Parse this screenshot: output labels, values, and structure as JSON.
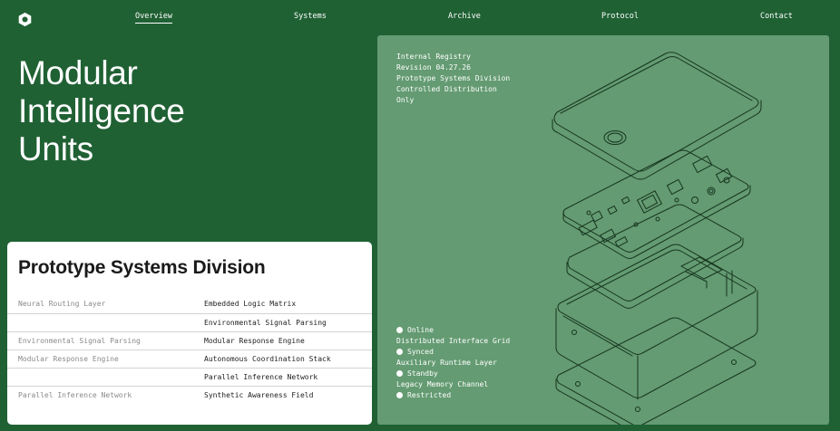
{
  "nav": {
    "items": [
      {
        "label": "Overview",
        "active": true
      },
      {
        "label": "Systems",
        "active": false
      },
      {
        "label": "Archive",
        "active": false
      },
      {
        "label": "Protocol",
        "active": false
      },
      {
        "label": "Contact",
        "active": false
      }
    ]
  },
  "hero": {
    "lines": [
      "Modular",
      "Intelligence",
      "Units"
    ]
  },
  "spec": {
    "title": "Prototype Systems Division",
    "rows": [
      {
        "key": "Neural Routing Layer",
        "value": "Embedded Logic Matrix"
      },
      {
        "key": "",
        "value": "Environmental Signal Parsing"
      },
      {
        "key": "Environmental Signal Parsing",
        "value": "Modular Response Engine"
      },
      {
        "key": "Modular Response Engine",
        "value": "Autonomous Coordination Stack"
      },
      {
        "key": "",
        "value": "Parallel Inference Network"
      },
      {
        "key": "Parallel Inference Network",
        "value": "Synthetic Awareness Field"
      }
    ]
  },
  "registry": {
    "lines": [
      "Internal Registry",
      "Revision 04.27.26",
      "Prototype Systems Division",
      "Controlled Distribution",
      "Only"
    ]
  },
  "status": {
    "online": "Online",
    "layer1": "Distributed Interface Grid",
    "synced": "Synced",
    "layer2": "Auxiliary Runtime Layer",
    "standby": "Standby",
    "layer3": "Legacy Memory Channel",
    "restricted": "Restricted"
  },
  "colors": {
    "background": "#206134",
    "panel": "#649b72",
    "card": "#ffffff",
    "line_art": "#16351f"
  },
  "icons": {
    "logo": "hexagon-ring-icon",
    "status": "dot-icon",
    "illustration": "exploded-device-illustration"
  }
}
